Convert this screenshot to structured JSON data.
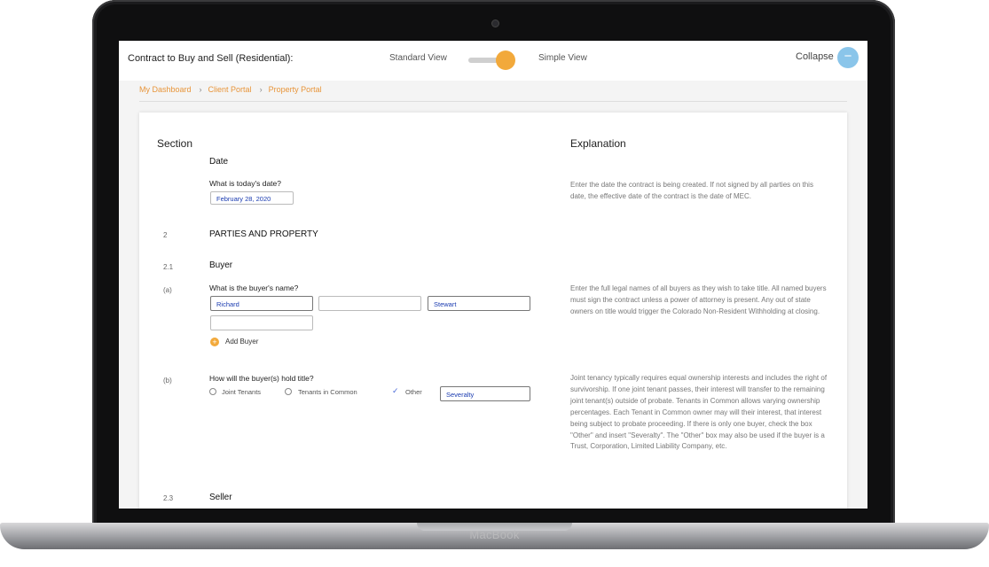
{
  "device": {
    "label": "MacBook"
  },
  "header": {
    "title": "Contract to Buy and Sell (Residential):",
    "view_standard": "Standard View",
    "view_simple": "Simple View",
    "collapse_label": "Collapse",
    "collapse_icon": "−"
  },
  "breadcrumb": {
    "items": [
      "My Dashboard",
      "Client Portal",
      "Property Portal"
    ],
    "separator": "›"
  },
  "columns": {
    "section": "Section",
    "explanation": "Explanation"
  },
  "date_block": {
    "heading": "Date",
    "question": "What is today's date?",
    "value": "February 28, 2020",
    "explanation": "Enter the date the contract is being created. If not signed by all parties on this date, the effective date of the contract is the date of MEC."
  },
  "parties": {
    "number": "2",
    "heading": "PARTIES AND PROPERTY"
  },
  "buyer": {
    "number": "2.1",
    "heading": "Buyer",
    "name_item": {
      "letter": "(a)",
      "question": "What is the buyer's name?",
      "first": "Richard",
      "middle": "",
      "last": "Stewart",
      "extra": "",
      "add_label": "Add Buyer",
      "add_icon": "+",
      "explanation": "Enter the full legal names of all buyers as they wish to take title. All named buyers must sign the contract unless a power of attorney is present. Any out of state owners on title would trigger the Colorado Non-Resident Withholding at closing."
    },
    "title_item": {
      "letter": "(b)",
      "question": "How will the buyer(s) hold title?",
      "options": [
        "Joint Tenants",
        "Tenants in Common",
        "Other"
      ],
      "check_icon": "✓",
      "other_value": "Severalty",
      "explanation": "Joint tenancy typically requires equal ownership interests and includes the right of survivorship. If one joint tenant passes, their interest will transfer to the remaining joint tenant(s) outside of probate. Tenants in Common allows varying ownership percentages. Each Tenant in Common owner may will their interest, that interest being subject to probate proceeding. If there is only one buyer, check the box \"Other\" and insert \"Severalty\". The \"Other\" box may also be used if the buyer is a Trust, Corporation, Limited Liability Company, etc."
    }
  },
  "seller": {
    "number": "2.3",
    "heading": "Seller"
  },
  "colors": {
    "accent": "#f2a93b",
    "link": "#e8953a",
    "collapse": "#8ac5ea",
    "value_text": "#1a3bb0"
  }
}
